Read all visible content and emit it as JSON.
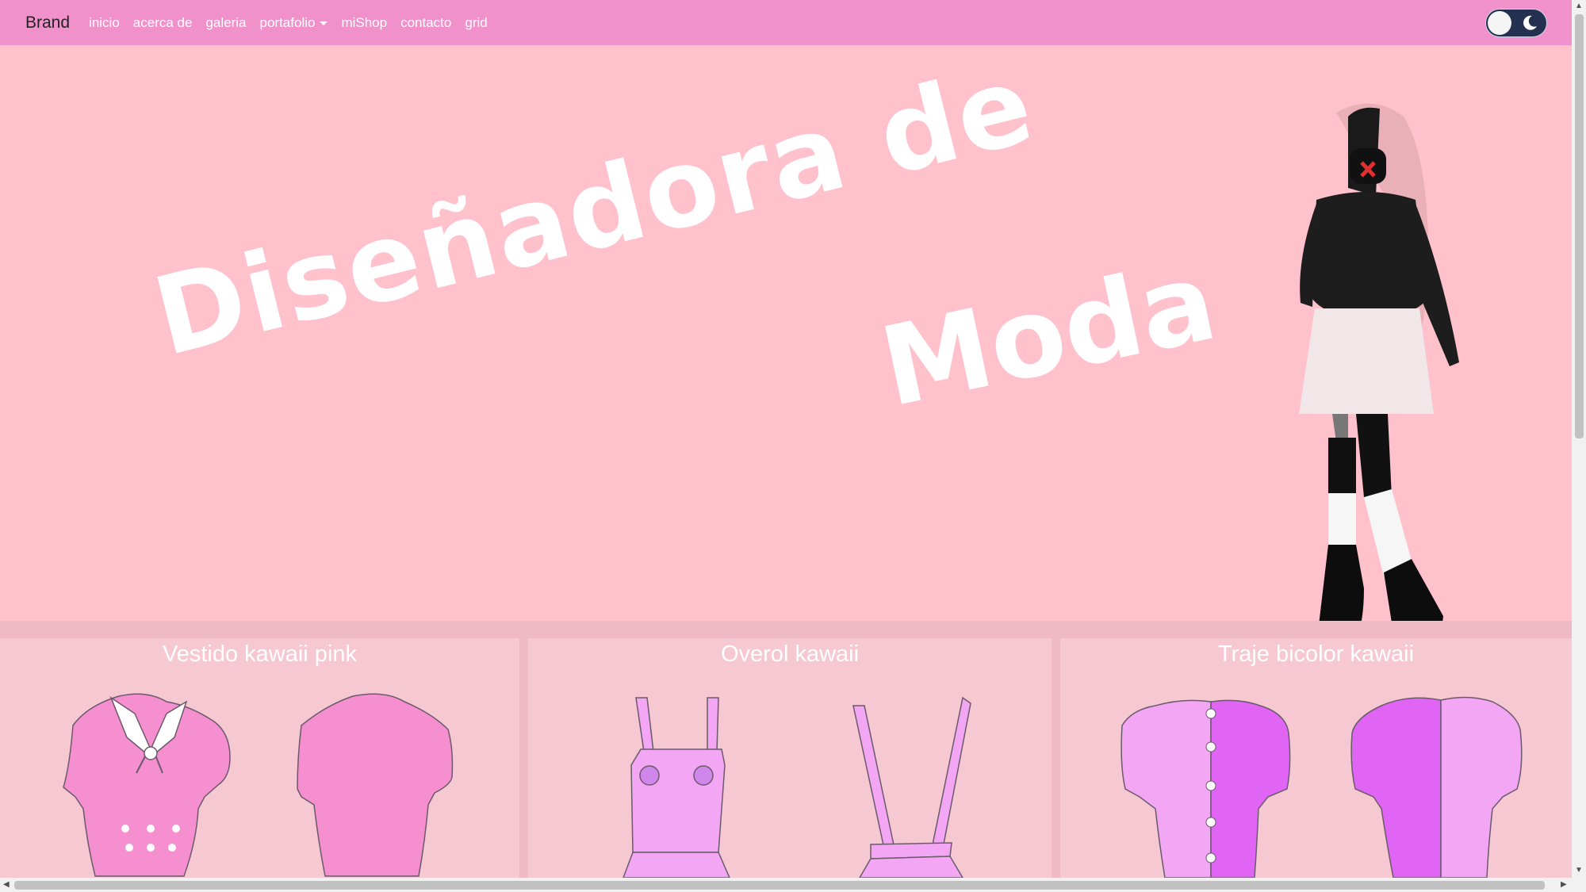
{
  "navbar": {
    "brand": "Brand",
    "links": [
      "inicio",
      "acerca de",
      "galeria",
      "portafolio",
      "miShop",
      "contacto",
      "grid"
    ],
    "theme_toggle_icon": "moon-icon"
  },
  "hero": {
    "title_line1": "Diseñadora de",
    "title_line2": "Moda"
  },
  "cards": [
    {
      "title": "Vestido kawaii pink"
    },
    {
      "title": "Overol kawaii"
    },
    {
      "title": "Traje bicolor kawaii"
    }
  ],
  "colors": {
    "navbar": "#f191cb",
    "hero_bg": "#ffc1cc",
    "card_bg": "#f6c8d2"
  }
}
